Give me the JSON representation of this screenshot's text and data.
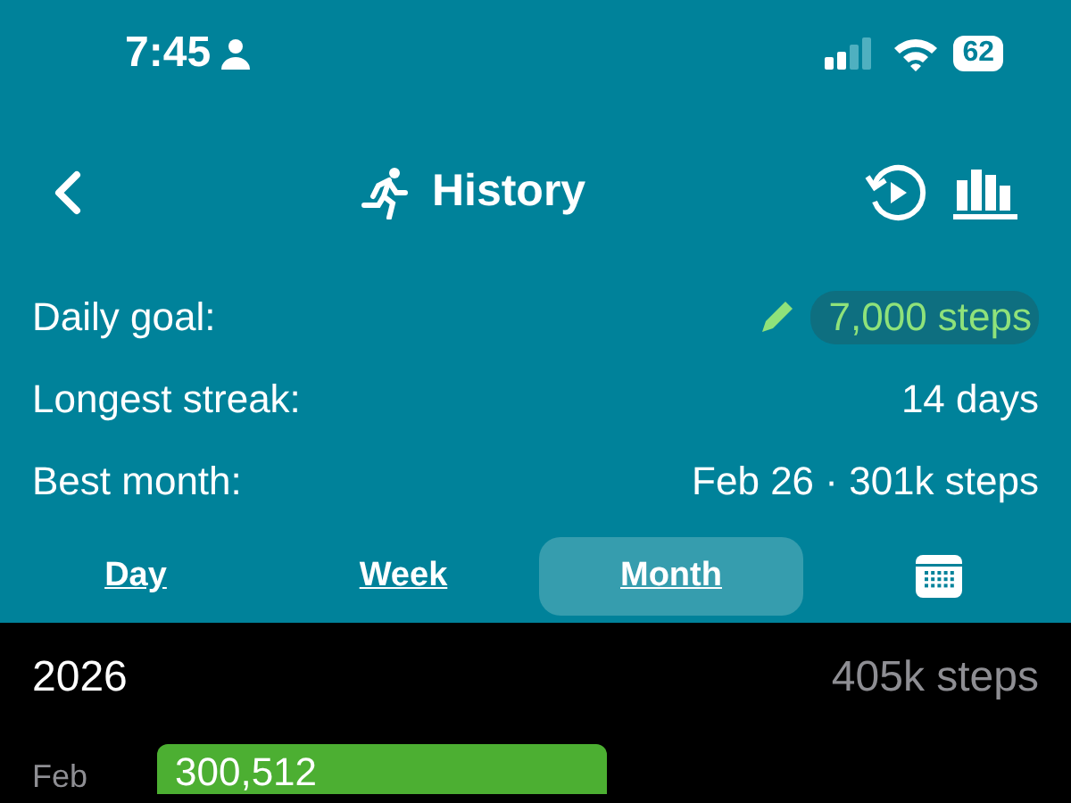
{
  "status_bar": {
    "time": "7:45",
    "battery": "62"
  },
  "nav": {
    "title": "History"
  },
  "stats": [
    {
      "label": "Daily goal:",
      "value": "7,000 steps",
      "editable": true
    },
    {
      "label": "Longest streak:",
      "value": "14 days",
      "editable": false
    },
    {
      "label": "Best month:",
      "value": "Feb 26 · 301k steps",
      "editable": false
    }
  ],
  "tabs": [
    {
      "label": "Day",
      "selected": false,
      "kind": "text"
    },
    {
      "label": "Week",
      "selected": false,
      "kind": "text"
    },
    {
      "label": "Month",
      "selected": true,
      "kind": "text"
    },
    {
      "selected": false,
      "kind": "calendar"
    }
  ],
  "year": {
    "label": "2026",
    "total": "405k steps"
  },
  "months": [
    {
      "label": "Feb",
      "value": "300,512"
    }
  ]
}
